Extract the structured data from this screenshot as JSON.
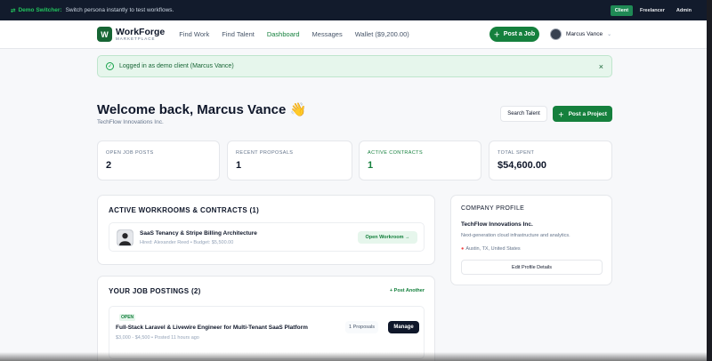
{
  "demo": {
    "lead": "Demo Switcher:",
    "text": "Switch persona instantly to test workflows.",
    "personas": [
      "Client",
      "Freelancer",
      "Admin"
    ],
    "active_persona": "Client"
  },
  "nav": {
    "logo_letter": "W",
    "logo_name": "WorkForge",
    "logo_sub": "MARKETPLACE",
    "links": [
      "Find Work",
      "Find Talent",
      "Dashboard",
      "Messages",
      "Wallet ($9,200.00)"
    ],
    "active_link": "Dashboard",
    "post_job": "Post a Job",
    "user_name": "Marcus Vance"
  },
  "alert": {
    "text": "Logged in as demo client (Marcus Vance)",
    "close": "×"
  },
  "header": {
    "welcome": "Welcome back, Marcus Vance 👋",
    "company": "TechFlow Innovations Inc.",
    "search_talent": "Search Talent",
    "post_project": "Post a Project"
  },
  "stats": [
    {
      "label": "OPEN JOB POSTS",
      "value": "2"
    },
    {
      "label": "RECENT PROPOSALS",
      "value": "1"
    },
    {
      "label": "ACTIVE CONTRACTS",
      "value": "1"
    },
    {
      "label": "TOTAL SPENT",
      "value": "$54,600.00"
    }
  ],
  "workrooms": {
    "title": "ACTIVE WORKROOMS & CONTRACTS (1)",
    "items": [
      {
        "title": "SaaS Tenancy & Stripe Billing Architecture",
        "sub": "Hired: Alexander Reed • Budget: $5,500.00",
        "action": "Open Workroom →"
      }
    ]
  },
  "profile": {
    "title": "COMPANY PROFILE",
    "name": "TechFlow Innovations Inc.",
    "description": "Next-generation cloud infrastructure and analytics.",
    "location": "Austin, TX, United States",
    "edit": "Edit Profile Details"
  },
  "postings": {
    "title": "YOUR JOB POSTINGS (2)",
    "add": "+ Post Another",
    "items": [
      {
        "status": "OPEN",
        "title": "Full-Stack Laravel & Livewire Engineer for Multi-Tenant SaaS Platform",
        "meta": "$3,000 - $4,500 • Posted 11 hours ago",
        "proposals": "1 Proposals",
        "manage": "Manage"
      }
    ]
  },
  "colors": {
    "brand": "#15803d",
    "demo_bar": "#121b2c",
    "alert_bg": "#e6f6ec"
  }
}
